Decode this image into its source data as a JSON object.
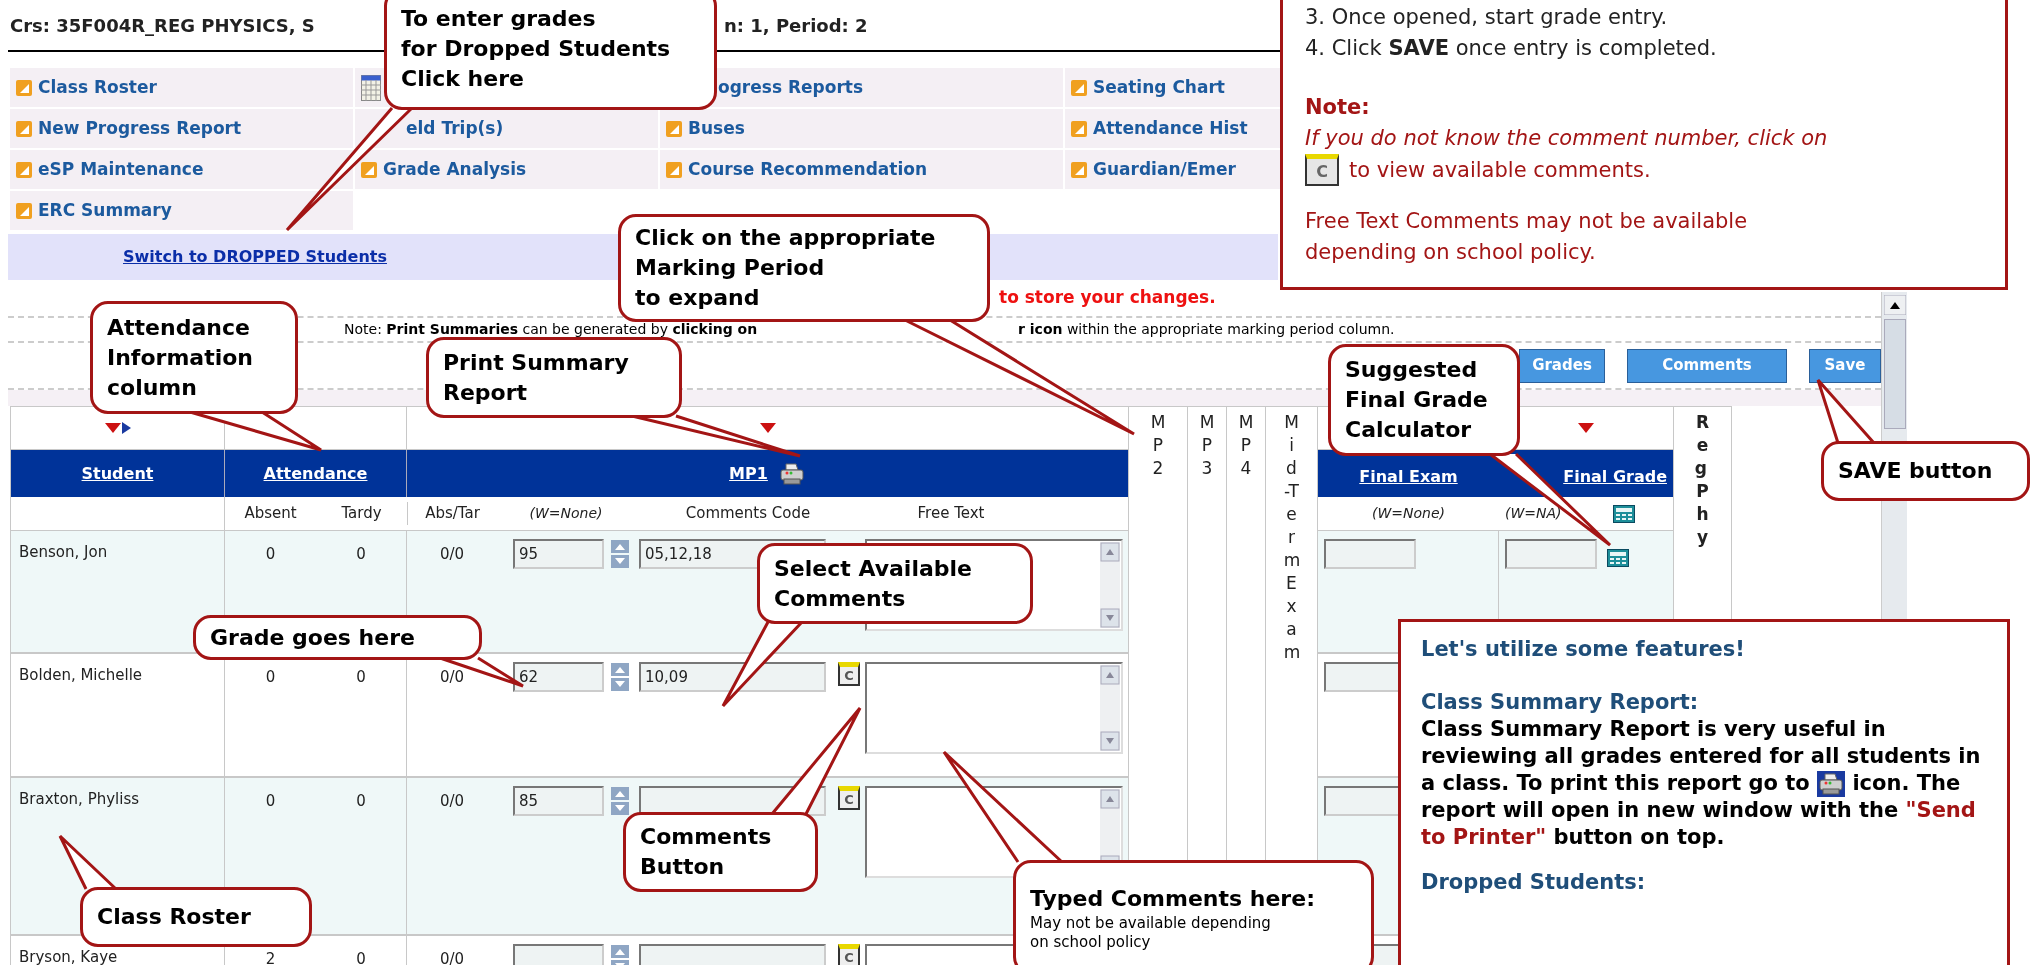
{
  "header": {
    "course": "Crs: 35F004R_REG PHYSICS, S",
    "period": "n: 1, Period: 2"
  },
  "nav": [
    [
      {
        "label": "Class Roster",
        "kind": "link"
      },
      {
        "kind": "calendar"
      },
      {
        "label": "ogress Reports",
        "kind": "partial"
      },
      {
        "label": "Seating Chart",
        "kind": "link"
      }
    ],
    [
      {
        "label": "New Progress Report",
        "kind": "link"
      },
      {
        "label": "eld Trip(s)",
        "kind": "partial"
      },
      {
        "label": "Buses",
        "kind": "link"
      },
      {
        "label": "Attendance Hist",
        "kind": "link"
      }
    ],
    [
      {
        "label": "eSP Maintenance",
        "kind": "link"
      },
      {
        "label": "Grade Analysis",
        "kind": "link"
      },
      {
        "label": "Course Recommendation",
        "kind": "link"
      },
      {
        "label": "Guardian/Emer",
        "kind": "link"
      }
    ],
    [
      {
        "label": "ERC Summary",
        "kind": "link"
      }
    ]
  ],
  "switch_link": "Switch to DROPPED Students",
  "save_reminder": "to store your changes.",
  "print_note": "Note: **Print Summaries** can be generated by **clicking on**",
  "print_note_end": "**r icon** within the appropriate marking period column.",
  "buttons": [
    {
      "label": "Grades"
    },
    {
      "label": "Comments"
    },
    {
      "label": "Save"
    }
  ],
  "table": {
    "student_header": "Student",
    "attendance_header": "Attendance",
    "mp1_header": "MP1",
    "absent": "Absent",
    "tardy": "Tardy",
    "abs_tar": "Abs/Tar",
    "weight": "(W=None)",
    "comments_code": "Comments Code",
    "free_text": "Free Text",
    "collapsed_periods": [
      "MP2",
      "MP3",
      "MP4",
      "Mid-Term Exam"
    ],
    "final_exam": {
      "header": "Final Exam",
      "weight": "(W=None)"
    },
    "final_grade": {
      "header": "Final Grade",
      "weight": "(W=NA)"
    },
    "last_column": "Reg Phy",
    "rows": [
      {
        "name": "Benson, Jon",
        "absent": "0",
        "tardy": "0",
        "abs_tar": "0/0",
        "grade": "95",
        "comments_code": "05,12,18",
        "calculator": true
      },
      {
        "name": "Bolden, Michelle",
        "absent": "0",
        "tardy": "0",
        "abs_tar": "0/0",
        "grade": "62",
        "comments_code": "10,09",
        "comment_button": "C"
      },
      {
        "name": "Braxton, Phyliss",
        "absent": "0",
        "tardy": "0",
        "abs_tar": "0/0",
        "grade": "85",
        "comment_button": "C"
      },
      {
        "name": "Bryson, Kaye",
        "absent": "2",
        "tardy": "0",
        "abs_tar": "0/0",
        "comment_button": "C"
      }
    ]
  },
  "instructions_box": {
    "step3": "3. Once opened, start grade entry.",
    "step4": "4. Click **SAVE** once entry is completed.",
    "note_title": "Note:",
    "note_italic": "If you do not know the comment number, click on",
    "icon_label": "C",
    "note_after": "to view available comments.",
    "policy": "Free Text Comments may not be available depending on school policy."
  },
  "callouts": [
    {
      "text": "To enter grades\nfor Dropped Students\nClick here"
    },
    {
      "text": "Click on the appropriate\nMarking Period\nto expand"
    },
    {
      "text": "Attendance\nInformation\ncolumn"
    },
    {
      "text": "Print Summary\nReport"
    },
    {
      "text": "Suggested\nFinal Grade\nCalculator"
    },
    {
      "text": "SAVE button"
    },
    {
      "text": "Select Available\nComments"
    },
    {
      "text": "Grade goes here"
    },
    {
      "text": "Comments\nButton"
    },
    {
      "text": "Class Roster"
    },
    {
      "text": "Typed Comments here:",
      "note": "May not be available depending\non school policy"
    }
  ],
  "features_box": {
    "title": "Let's utilize some features!",
    "section": "Class Summary Report:",
    "before": "Class Summary Report is very useful in reviewing all grades entered for all students in a class. To print this report go to",
    "after": "icon. The report will open in new window with the",
    "highlight": "\"Send to Printer\"",
    "after_end": "button on top.",
    "next_section": "Dropped Students:"
  }
}
